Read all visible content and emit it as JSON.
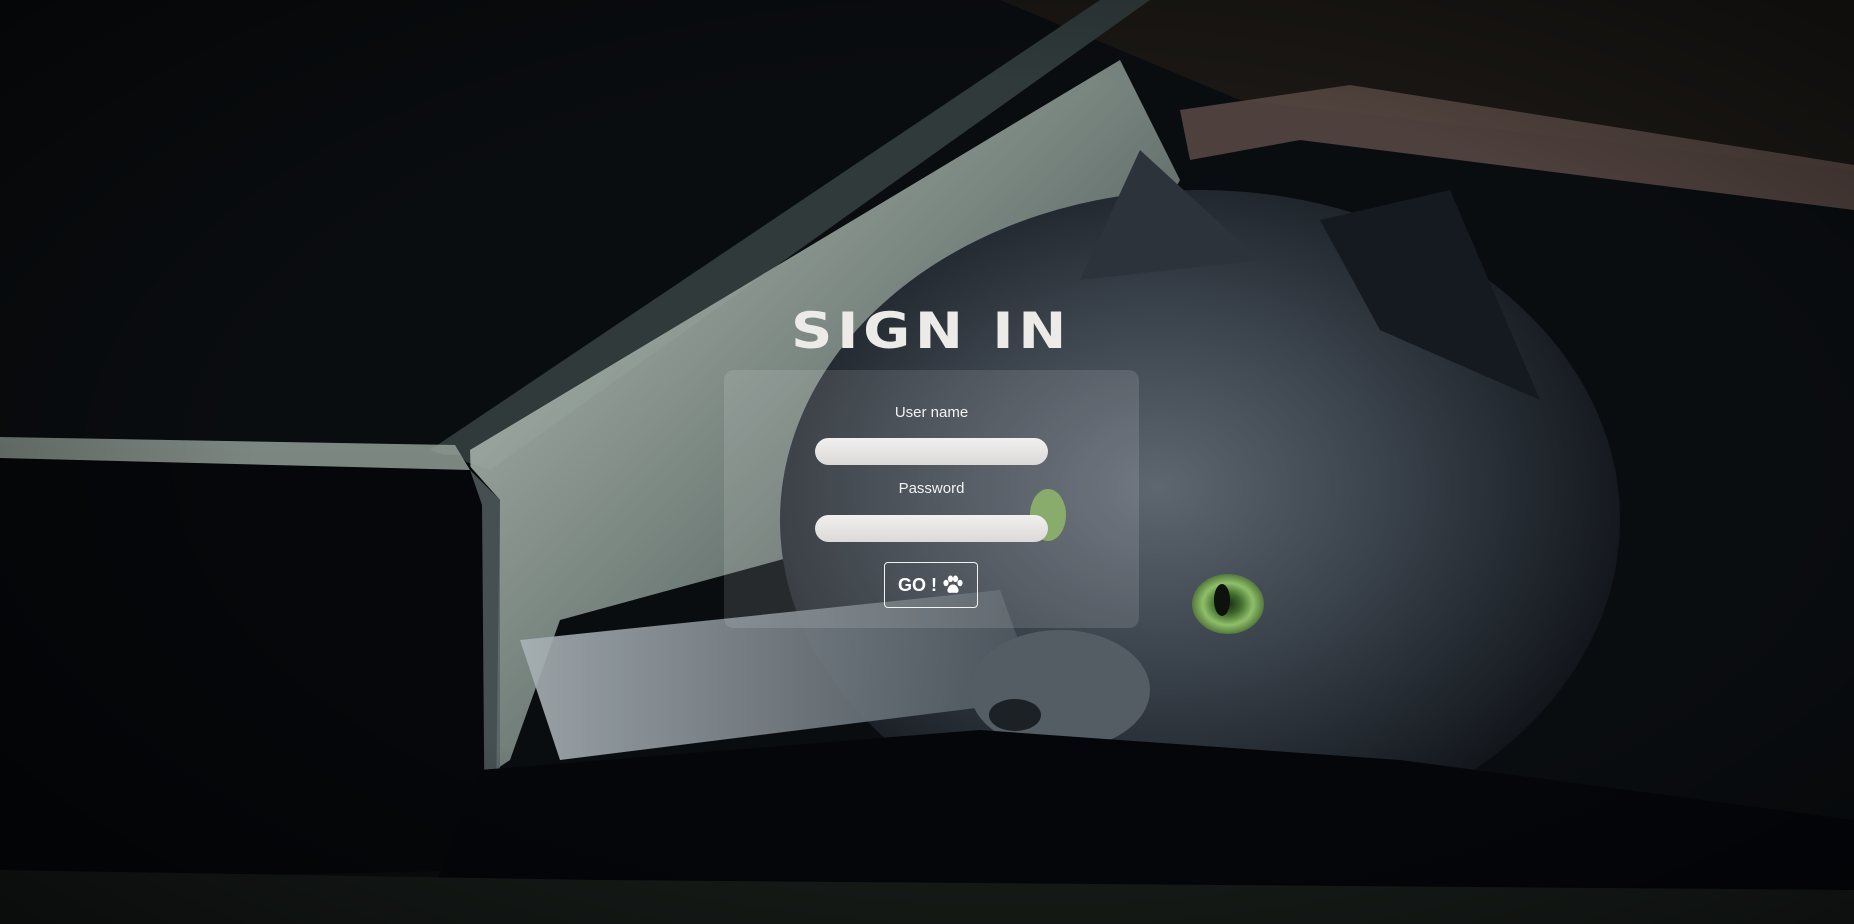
{
  "page": {
    "title": "SIGN IN"
  },
  "form": {
    "username_label": "User name",
    "username_value": "",
    "password_label": "Password",
    "password_value": "",
    "submit_label": "GO !",
    "submit_icon": "paw-icon"
  },
  "background": {
    "subject": "gray cat with green eyes under a laptop lid",
    "eye_color": "#8fbf6a",
    "tone": "#0a0c0e"
  }
}
